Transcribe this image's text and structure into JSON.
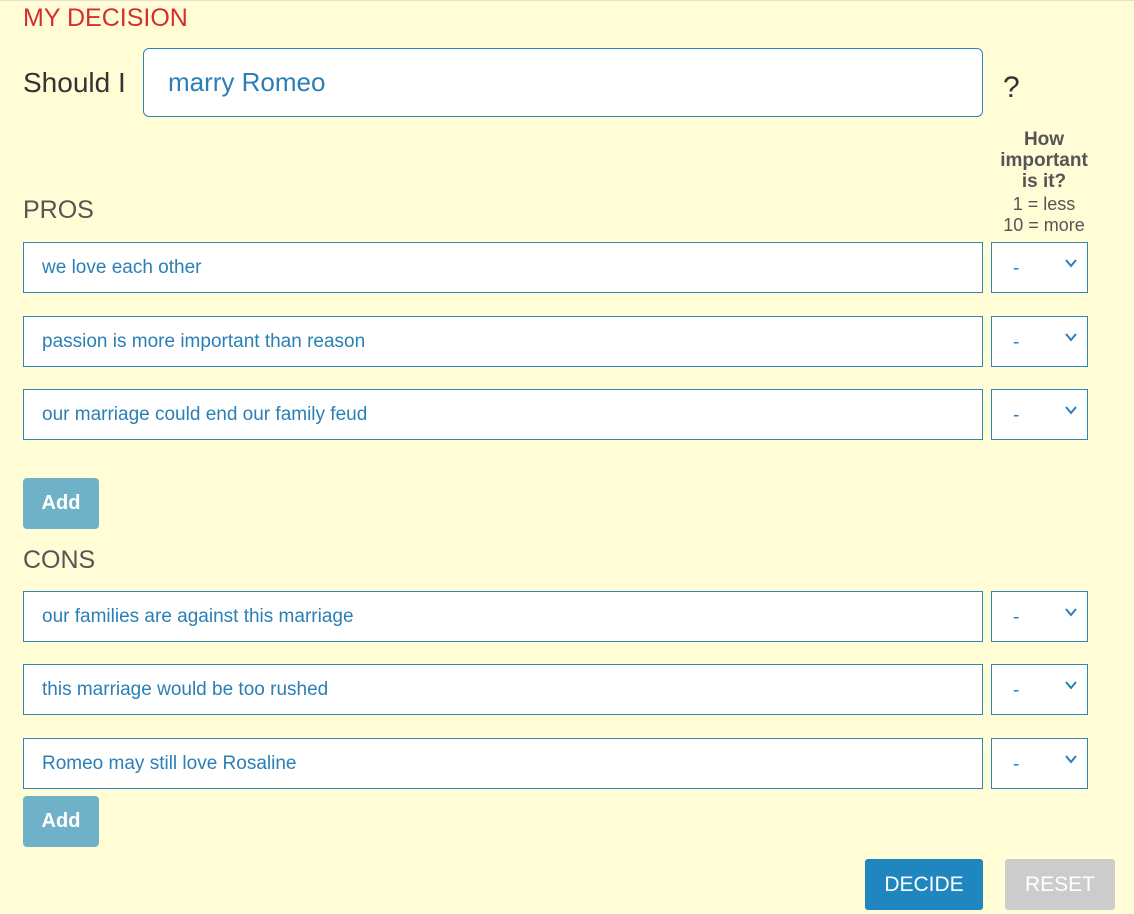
{
  "header": {
    "title": "MY DECISION"
  },
  "question": {
    "prefix": "Should I",
    "value": "marry Romeo",
    "suffix": "?"
  },
  "importance": {
    "heading": "How important is it?",
    "scale_low": "1 = less",
    "scale_high": "10 = more"
  },
  "pros": {
    "label": "PROS",
    "items": [
      {
        "text": "we love each other",
        "weight": "-"
      },
      {
        "text": "passion is more important than reason",
        "weight": "-"
      },
      {
        "text": "our marriage could end our family feud",
        "weight": "-"
      }
    ],
    "add_label": "Add"
  },
  "cons": {
    "label": "CONS",
    "items": [
      {
        "text": "our families are against this marriage",
        "weight": "-"
      },
      {
        "text": "this marriage would be too rushed",
        "weight": "-"
      },
      {
        "text": "Romeo may still love Rosaline",
        "weight": "-"
      }
    ],
    "add_label": "Add"
  },
  "actions": {
    "decide_label": "DECIDE",
    "reset_label": "RESET"
  },
  "colors": {
    "background": "#fffcd6",
    "title": "#d32f2f",
    "accent": "#1f86c0",
    "input_text": "#2b7fb6",
    "add_button": "#6fb2c8",
    "reset_button": "#cccccc"
  },
  "icons": {
    "dropdown": "chevron-down-icon"
  }
}
